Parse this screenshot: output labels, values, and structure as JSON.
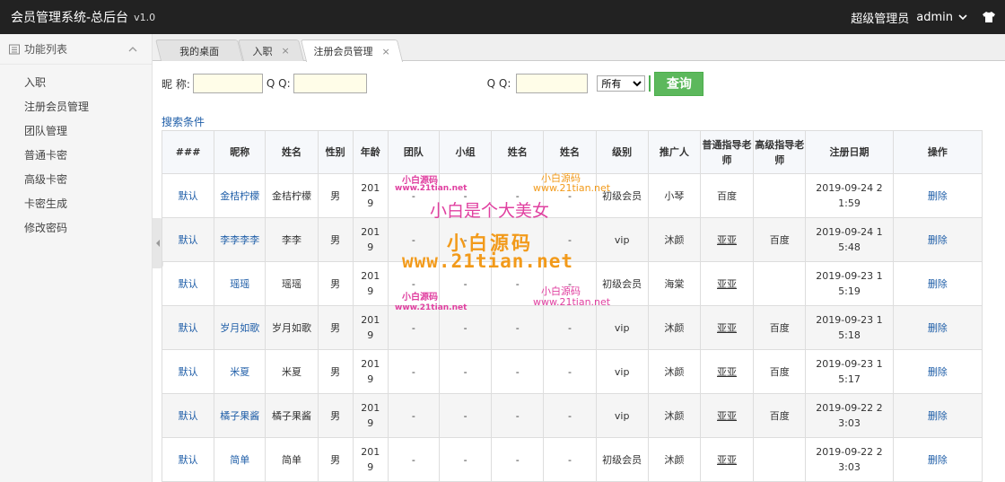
{
  "header": {
    "title": "会员管理系统-总后台",
    "version": "v1.0",
    "role": "超级管理员",
    "user": "admin"
  },
  "sidebar": {
    "heading": "功能列表",
    "items": [
      {
        "label": "入职"
      },
      {
        "label": "注册会员管理"
      },
      {
        "label": "团队管理"
      },
      {
        "label": "普通卡密"
      },
      {
        "label": "高级卡密"
      },
      {
        "label": "卡密生成"
      },
      {
        "label": "修改密码"
      }
    ]
  },
  "tabs": [
    {
      "label": "我的桌面"
    },
    {
      "label": "入职"
    },
    {
      "label": "注册会员管理"
    }
  ],
  "search": {
    "nickname_label": "昵 称:",
    "qq_label": "Q Q:",
    "qq2_label": "Q Q:",
    "select_value": "所有",
    "query_button": "查询"
  },
  "criteria_label": "搜索条件",
  "table": {
    "headers": [
      "###",
      "昵称",
      "姓名",
      "性别",
      "年龄",
      "团队",
      "小组",
      "姓名",
      "姓名",
      "级别",
      "推广人",
      "普通指导老师",
      "高级指导老师",
      "注册日期",
      "操作"
    ],
    "rows": [
      {
        "c0": "默认",
        "c1": "金桔柠檬",
        "c2": "金桔柠檬",
        "c3": "男",
        "c4": "2019",
        "c5": "-",
        "c6": "-",
        "c7": "-",
        "c8": "-",
        "c9": "初级会员",
        "c10": "小琴",
        "c11": "百度",
        "c12": "",
        "c13": "2019-09-24 21:59",
        "c14": "删除"
      },
      {
        "c0": "默认",
        "c1": "李李李李",
        "c2": "李李",
        "c3": "男",
        "c4": "2019",
        "c5": "-",
        "c6": "-",
        "c7": "-",
        "c8": "-",
        "c9": "vip",
        "c10": "沐颜",
        "c11": "亚亚",
        "c12": "百度",
        "c13": "2019-09-24 15:48",
        "c14": "删除"
      },
      {
        "c0": "默认",
        "c1": "瑶瑶",
        "c2": "瑶瑶",
        "c3": "男",
        "c4": "2019",
        "c5": "-",
        "c6": "-",
        "c7": "-",
        "c8": "-",
        "c9": "初级会员",
        "c10": "海棠",
        "c11": "亚亚",
        "c12": "",
        "c13": "2019-09-23 15:19",
        "c14": "删除"
      },
      {
        "c0": "默认",
        "c1": "岁月如歌",
        "c2": "岁月如歌",
        "c3": "男",
        "c4": "2019",
        "c5": "-",
        "c6": "-",
        "c7": "-",
        "c8": "-",
        "c9": "vip",
        "c10": "沐颜",
        "c11": "亚亚",
        "c12": "百度",
        "c13": "2019-09-23 15:18",
        "c14": "删除"
      },
      {
        "c0": "默认",
        "c1": "米夏",
        "c2": "米夏",
        "c3": "男",
        "c4": "2019",
        "c5": "-",
        "c6": "-",
        "c7": "-",
        "c8": "-",
        "c9": "vip",
        "c10": "沐颜",
        "c11": "亚亚",
        "c12": "百度",
        "c13": "2019-09-23 15:17",
        "c14": "删除"
      },
      {
        "c0": "默认",
        "c1": "橘子果酱",
        "c2": "橘子果酱",
        "c3": "男",
        "c4": "2019",
        "c5": "-",
        "c6": "-",
        "c7": "-",
        "c8": "-",
        "c9": "vip",
        "c10": "沐颜",
        "c11": "亚亚",
        "c12": "百度",
        "c13": "2019-09-22 23:03",
        "c14": "删除"
      },
      {
        "c0": "默认",
        "c1": "简单",
        "c2": "简单",
        "c3": "男",
        "c4": "2019",
        "c5": "-",
        "c6": "-",
        "c7": "-",
        "c8": "-",
        "c9": "初级会员",
        "c10": "沐颜",
        "c11": "亚亚",
        "c12": "",
        "c13": "2019-09-22 23:03",
        "c14": "删除"
      }
    ]
  },
  "watermarks": {
    "small_cn": "小白源码",
    "small_url": "www.21tian.net",
    "big_slogan": "小白是个大美女",
    "big_cn": "小白源码",
    "big_url": "www.21tian.net"
  },
  "colors": {
    "topbar": "#222222",
    "link": "#1f5ea8",
    "query_button": "#5cb85c",
    "watermark_pink": "#e040a0",
    "watermark_orange": "#f29a1a"
  }
}
